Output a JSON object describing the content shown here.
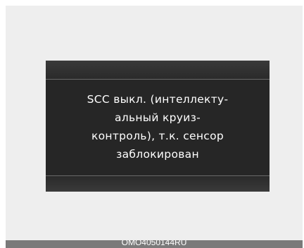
{
  "display": {
    "message_lines": [
      "SCC выкл. (интеллекту-",
      "альный круиз-",
      "контроль), т.к. сенсор",
      "заблокирован"
    ]
  },
  "footer": {
    "image_code": "OMO4050144RU"
  }
}
